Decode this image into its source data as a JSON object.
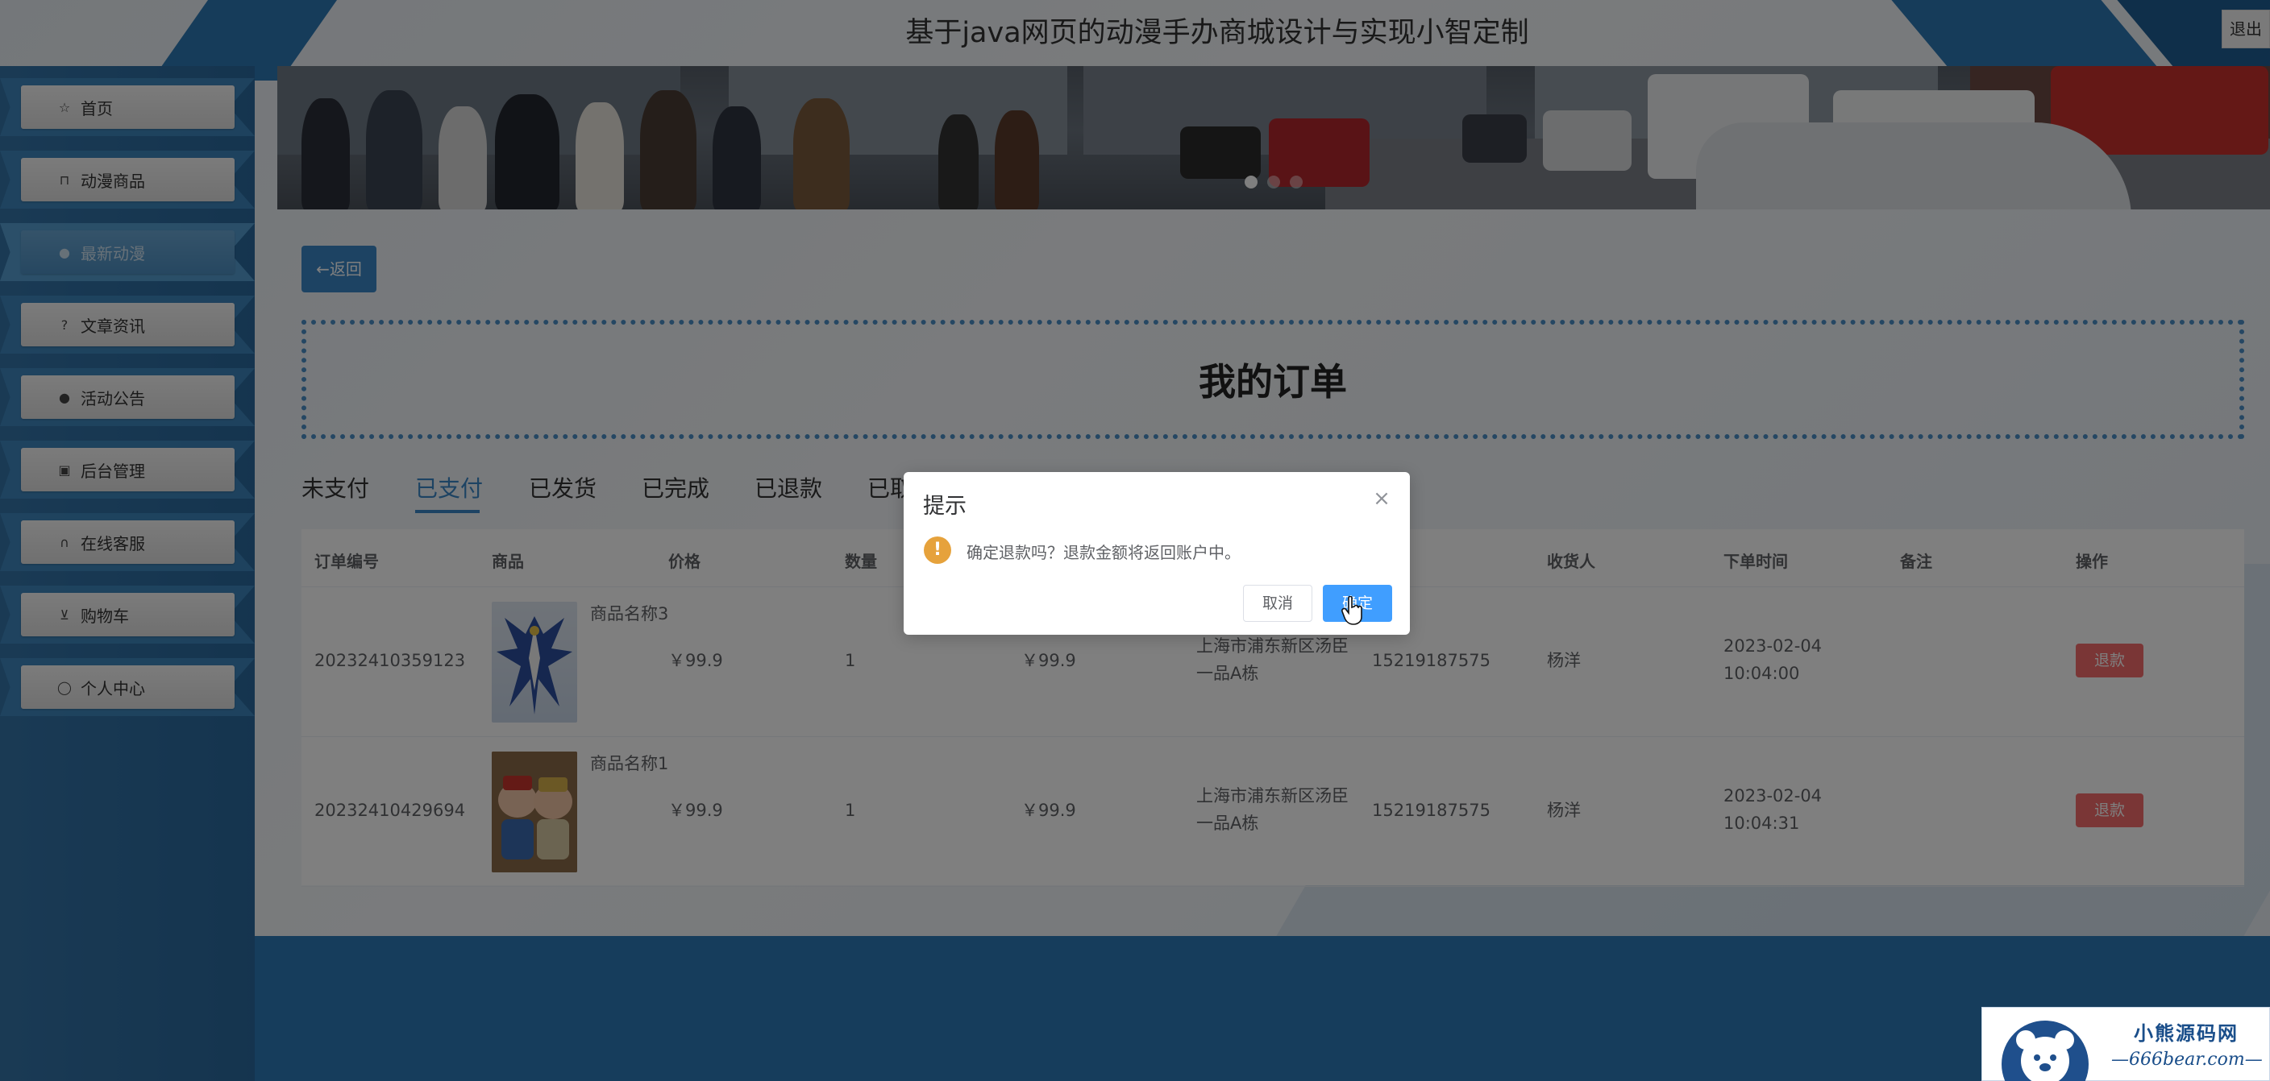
{
  "header": {
    "title": "基于java网页的动漫手办商城设计与实现小智定制",
    "logout_label": "退出"
  },
  "sidebar": {
    "items": [
      {
        "label": "首页",
        "icon": "star-icon"
      },
      {
        "label": "动漫商品",
        "icon": "bag-icon"
      },
      {
        "label": "最新动漫",
        "icon": "info-icon"
      },
      {
        "label": "文章资讯",
        "icon": "question-icon"
      },
      {
        "label": "活动公告",
        "icon": "info-icon"
      },
      {
        "label": "后台管理",
        "icon": "briefcase-icon"
      },
      {
        "label": "在线客服",
        "icon": "headset-icon"
      },
      {
        "label": "购物车",
        "icon": "cart-icon"
      },
      {
        "label": "个人中心",
        "icon": "user-icon"
      }
    ],
    "active_index": 2
  },
  "main": {
    "back_label": "←返回",
    "page_title": "我的订单",
    "tabs": [
      "未支付",
      "已支付",
      "已发货",
      "已完成",
      "已退款",
      "已取消"
    ],
    "active_tab": 1,
    "table": {
      "columns": [
        "订单编号",
        "商品",
        "价格",
        "数量",
        "",
        "",
        "收货人",
        "下单时间",
        "备注",
        "操作"
      ],
      "rows": [
        {
          "order_no": "20232410359123",
          "product_name": "商品名称3",
          "price": "￥99.9",
          "quantity": "1",
          "total": "￥99.9",
          "address": "上海市浦东新区汤臣一品A栋",
          "phone": "15219187575",
          "receiver": "杨洋",
          "order_time": "2023-02-04 10:04:00",
          "note": "",
          "action": "退款"
        },
        {
          "order_no": "20232410429694",
          "product_name": "商品名称1",
          "price": "￥99.9",
          "quantity": "1",
          "total": "￥99.9",
          "address": "上海市浦东新区汤臣一品A栋",
          "phone": "15219187575",
          "receiver": "杨洋",
          "order_time": "2023-02-04 10:04:31",
          "note": "",
          "action": "退款"
        }
      ]
    }
  },
  "dialog": {
    "title": "提示",
    "message": "确定退款吗？退款金额将返回账户中。",
    "cancel_label": "取消",
    "confirm_label": "确定"
  },
  "watermark": {
    "line1": "小熊源码网",
    "line2": "—666bear.com—"
  },
  "colors": {
    "primary": "#409eff",
    "accent_blue": "#3a87c6",
    "danger": "#f56c6c",
    "warning": "#e6a23c",
    "sidebar": "#2c6fa6"
  }
}
